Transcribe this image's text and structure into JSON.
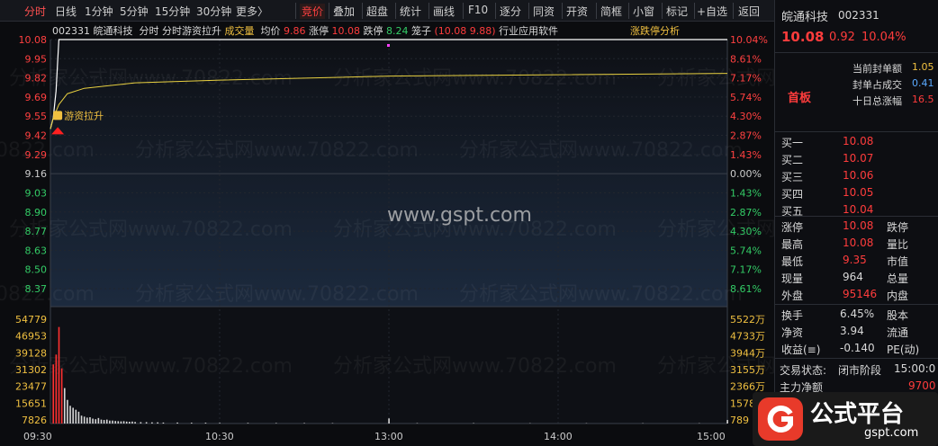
{
  "toolbar": {
    "items": [
      "分时",
      "日线",
      "1分钟",
      "5分钟",
      "15分钟",
      "30分钟",
      "更多〉",
      "竞价",
      "叠加",
      "超盘",
      "统计",
      "画线",
      "F10",
      "逐分",
      "同资",
      "开资",
      "简框",
      "小窗",
      "标记",
      "+自选",
      "返回"
    ]
  },
  "header": {
    "code": "002331",
    "name": "皖通科技",
    "mode": "分时",
    "indicator": "分时游资拉升",
    "volume_label": "成交量",
    "avg_label": "均价",
    "avg_value": "9.86",
    "limit_up_label": "涨停",
    "limit_up_value": "10.08",
    "limit_down_label": "跌停",
    "limit_down_value": "8.24",
    "cage_label": "笼子",
    "cage_value": "(10.08 9.88)",
    "sector": "行业应用软件",
    "analysis": "涨跌停分析"
  },
  "watermark": {
    "center": "www.gspt.com",
    "tile": "分析家公式网www.70822.com"
  },
  "chart_data": {
    "type": "line",
    "price_ticks": [
      "10.08",
      "9.95",
      "9.82",
      "9.69",
      "9.55",
      "9.42",
      "9.29",
      "9.16",
      "9.03",
      "8.90",
      "8.77",
      "8.63",
      "8.50",
      "8.37"
    ],
    "pct_ticks": [
      "10.04%",
      "8.61%",
      "7.17%",
      "5.74%",
      "4.30%",
      "2.87%",
      "1.43%",
      "0.00%",
      "1.43%",
      "2.87%",
      "4.30%",
      "5.74%",
      "7.17%",
      "8.61%"
    ],
    "vol_ticks": [
      "54779",
      "46953",
      "39128",
      "31302",
      "23477",
      "15651",
      "7826"
    ],
    "vol_right_ticks": [
      "5522万",
      "4733万",
      "3944万",
      "3155万",
      "2366万",
      "1578万",
      "789"
    ],
    "time_ticks": [
      "09:30",
      "10:30",
      "13:00",
      "14:00",
      "15:00"
    ],
    "ylim": [
      8.24,
      10.08
    ],
    "prev_close": 9.16,
    "price_series": [
      [
        0,
        9.42
      ],
      [
        1,
        9.5
      ],
      [
        2,
        9.7
      ],
      [
        3,
        10.08
      ],
      [
        240,
        10.08
      ]
    ],
    "avg_series": [
      [
        0,
        9.42
      ],
      [
        1,
        9.5
      ],
      [
        3,
        9.6
      ],
      [
        6,
        9.68
      ],
      [
        12,
        9.72
      ],
      [
        30,
        9.76
      ],
      [
        60,
        9.78
      ],
      [
        120,
        9.81
      ],
      [
        180,
        9.82
      ],
      [
        240,
        9.83
      ]
    ],
    "volume_max": 54779,
    "volumes": [
      [
        1,
        30000,
        "red"
      ],
      [
        2,
        35000,
        "red"
      ],
      [
        3,
        49000,
        "red"
      ],
      [
        4,
        28000,
        "red"
      ],
      [
        5,
        18000,
        "w"
      ],
      [
        6,
        12000,
        "w"
      ],
      [
        7,
        9000,
        "w"
      ],
      [
        8,
        8000,
        "w"
      ],
      [
        9,
        7000,
        "w"
      ],
      [
        10,
        6000,
        "w"
      ],
      [
        11,
        4000,
        "w"
      ],
      [
        12,
        3500,
        "w"
      ],
      [
        13,
        3000,
        "w"
      ],
      [
        14,
        3200,
        "w"
      ],
      [
        15,
        2500,
        "w"
      ],
      [
        16,
        2200,
        "w"
      ],
      [
        17,
        2800,
        "w"
      ],
      [
        18,
        2000,
        "w"
      ],
      [
        19,
        1800,
        "w"
      ],
      [
        20,
        2000,
        "w"
      ],
      [
        21,
        1500,
        "w"
      ],
      [
        22,
        1500,
        "w"
      ],
      [
        23,
        1300,
        "w"
      ],
      [
        24,
        1200,
        "w"
      ],
      [
        25,
        1100,
        "w"
      ],
      [
        26,
        1200,
        "w"
      ],
      [
        27,
        1000,
        "w"
      ],
      [
        28,
        900,
        "w"
      ],
      [
        29,
        1000,
        "w"
      ],
      [
        30,
        800,
        "w"
      ],
      [
        32,
        700,
        "w"
      ],
      [
        34,
        700,
        "w"
      ],
      [
        36,
        600,
        "w"
      ],
      [
        38,
        600,
        "w"
      ],
      [
        40,
        500,
        "w"
      ],
      [
        45,
        500,
        "w"
      ],
      [
        50,
        400,
        "w"
      ],
      [
        55,
        400,
        "w"
      ],
      [
        60,
        300,
        "w"
      ],
      [
        70,
        300,
        "w"
      ],
      [
        80,
        250,
        "w"
      ],
      [
        90,
        250,
        "w"
      ],
      [
        100,
        200,
        "w"
      ],
      [
        120,
        2600,
        "w"
      ],
      [
        130,
        200,
        "w"
      ],
      [
        150,
        200,
        "w"
      ],
      [
        170,
        150,
        "w"
      ],
      [
        190,
        150,
        "w"
      ],
      [
        210,
        150,
        "w"
      ],
      [
        230,
        150,
        "w"
      ],
      [
        240,
        1800,
        "w"
      ]
    ],
    "annotation": "游资拉升"
  },
  "panel": {
    "name": "皖通科技",
    "code": "002331",
    "price": "10.08",
    "change": "0.92",
    "pct": "10.04%",
    "seal_label": "当前封单额",
    "seal_value": "1.05",
    "seal_ratio_label": "封单占成交",
    "seal_ratio_value": "0.41",
    "ten_day_label": "十日总涨幅",
    "ten_day_value": "16.5",
    "board": "首板",
    "buys": [
      {
        "label": "买一",
        "price": "10.08"
      },
      {
        "label": "买二",
        "price": "10.07"
      },
      {
        "label": "买三",
        "price": "10.06"
      },
      {
        "label": "买四",
        "price": "10.05"
      },
      {
        "label": "买五",
        "price": "10.04"
      }
    ],
    "stats": [
      {
        "l1": "涨停",
        "v1": "10.08",
        "l2": "跌停"
      },
      {
        "l1": "最高",
        "v1": "10.08",
        "l2": "量比"
      },
      {
        "l1": "最低",
        "v1": "9.35",
        "l2": "市值"
      },
      {
        "l1": "现量",
        "v1": "964",
        "l2": "总量"
      },
      {
        "l1": "外盘",
        "v1": "95146",
        "l2": "内盘"
      }
    ],
    "stats2": [
      {
        "l1": "换手",
        "v1": "6.45%",
        "l2": "股本"
      },
      {
        "l1": "净资",
        "v1": "3.94",
        "l2": "流通"
      },
      {
        "l1": "收益(≡)",
        "v1": "-0.140",
        "l2": "PE(动)"
      }
    ],
    "trade_state_label": "交易状态:",
    "trade_state_value": "闭市阶段",
    "trade_time": "15:00:0",
    "main_flow_label": "主力净额",
    "main_flow_value": "9700"
  },
  "logo": {
    "text": "公式平台",
    "url": "gspt.com"
  }
}
